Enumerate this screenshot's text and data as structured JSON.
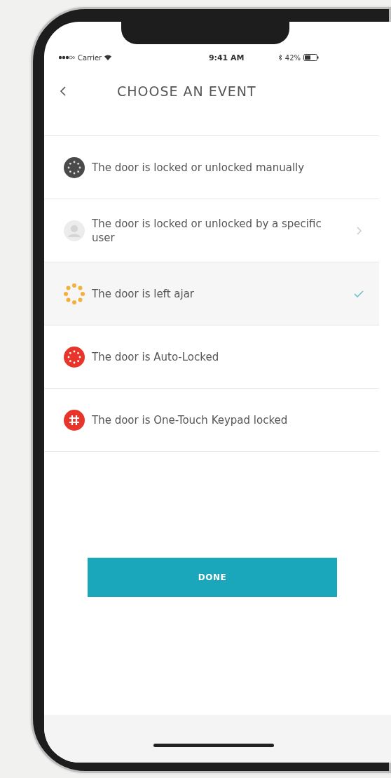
{
  "status_bar": {
    "carrier": "Carrier",
    "time": "9:41 AM",
    "battery": "42%"
  },
  "header": {
    "title": "CHOOSE AN EVENT"
  },
  "events": [
    {
      "kind": "dial-dark",
      "label": "The door is locked or unlocked manually",
      "selected": false,
      "chevron": false
    },
    {
      "kind": "user",
      "label": "The door is locked or unlocked by a specific user",
      "selected": false,
      "chevron": true
    },
    {
      "kind": "dial-amber",
      "label": "The door is left ajar",
      "selected": true,
      "chevron": false
    },
    {
      "kind": "dial-red",
      "label": "The door is Auto-Locked",
      "selected": false,
      "chevron": false
    },
    {
      "kind": "keypad-red",
      "label": "The door is One-Touch Keypad locked",
      "selected": false,
      "chevron": false
    }
  ],
  "done_button": {
    "label": "DONE"
  }
}
